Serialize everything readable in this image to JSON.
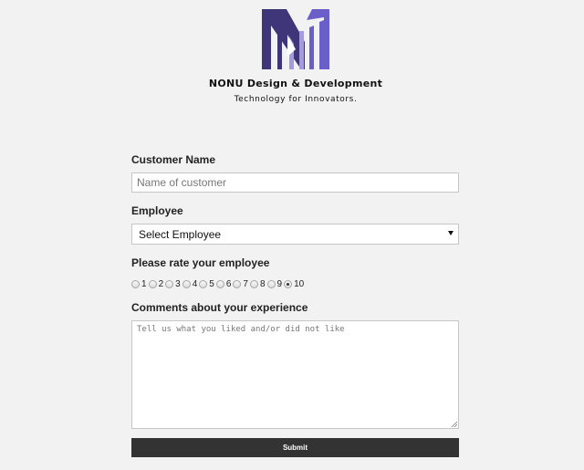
{
  "brand": {
    "title": "NONU Design & Development",
    "tagline": "Technology for Innovators.",
    "colors": {
      "logo_dark": "#3e3678",
      "logo_mid": "#6a5fc9",
      "logo_light": "#a39bde"
    }
  },
  "form": {
    "customer_name": {
      "label": "Customer Name",
      "placeholder": "Name of customer",
      "value": ""
    },
    "employee": {
      "label": "Employee",
      "selected": "Select Employee"
    },
    "rating": {
      "label": "Please rate your employee",
      "options": [
        "1",
        "2",
        "3",
        "4",
        "5",
        "6",
        "7",
        "8",
        "9",
        "10"
      ],
      "selected": "10"
    },
    "comments": {
      "label": "Comments about your experience",
      "placeholder": "Tell us what you liked and/or did not like",
      "value": ""
    },
    "submit_label": "Submit"
  },
  "colors": {
    "background": "#f2f2f2",
    "submit_bg": "#333333"
  }
}
